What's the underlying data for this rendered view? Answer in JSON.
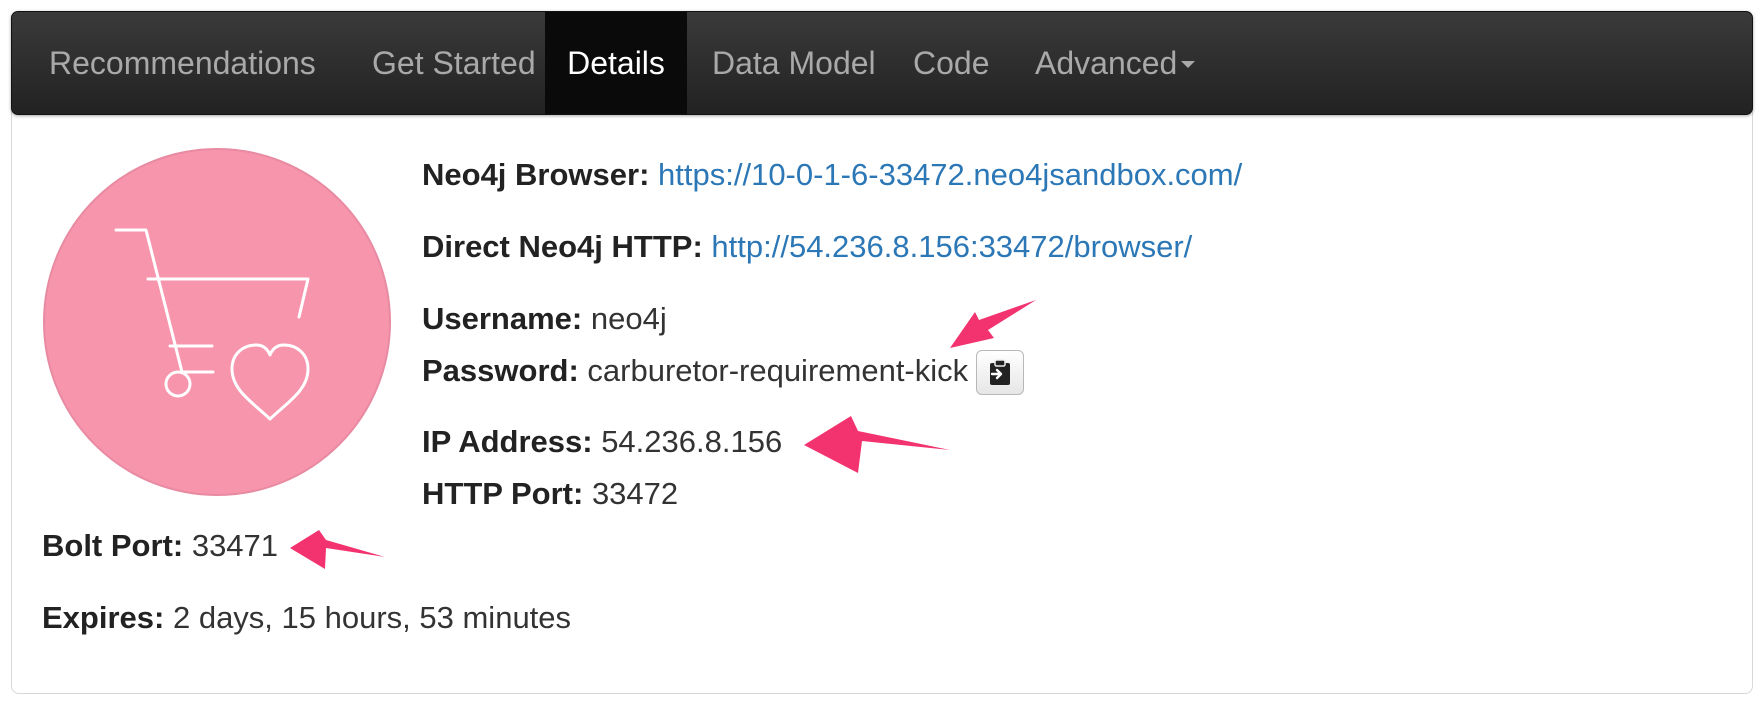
{
  "nav": {
    "tabs": [
      {
        "label": "Recommendations"
      },
      {
        "label": "Get Started"
      },
      {
        "label": "Details"
      },
      {
        "label": "Data Model"
      },
      {
        "label": "Code"
      },
      {
        "label": "Advanced"
      }
    ],
    "active_tab": "Details"
  },
  "logo": {
    "icon": "shopping-cart-heart-icon",
    "color": "#f795ad"
  },
  "details": {
    "browser": {
      "label": "Neo4j Browser:",
      "value": "https://10-0-1-6-33472.neo4jsandbox.com/"
    },
    "http": {
      "label": "Direct Neo4j HTTP:",
      "value": "http://54.236.8.156:33472/browser/"
    },
    "username": {
      "label": "Username:",
      "value": "neo4j"
    },
    "password": {
      "label": "Password:",
      "value": "carburetor-requirement-kick"
    },
    "ip": {
      "label": "IP Address:",
      "value": "54.236.8.156"
    },
    "http_port": {
      "label": "HTTP Port:",
      "value": "33472"
    },
    "bolt_port": {
      "label": "Bolt Port:",
      "value": "33471"
    },
    "expires": {
      "label": "Expires:",
      "value": "2 days, 15 hours, 53 minutes"
    }
  },
  "copy_button": {
    "icon": "clipboard-icon"
  },
  "annotations": {
    "arrow_color": "#f2336f"
  }
}
